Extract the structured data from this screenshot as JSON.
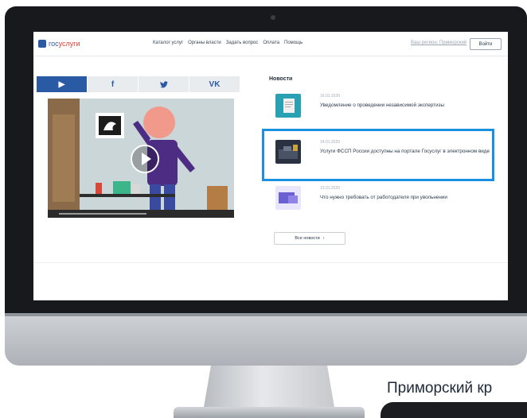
{
  "header": {
    "logo_text_blue": "гос",
    "logo_text_red": "услуги",
    "nav": [
      "Каталог услуг",
      "Органы власти",
      "Задать вопрос",
      "Оплата",
      "Помощь"
    ],
    "search_link": "Ваш регион: Приморский",
    "login_label": "Войти"
  },
  "share": {
    "tabs": [
      {
        "icon": "play-icon",
        "glyph": "▶"
      },
      {
        "icon": "facebook-icon",
        "glyph": "f"
      },
      {
        "icon": "twitter-icon",
        "glyph": "♥"
      },
      {
        "icon": "vk-icon",
        "glyph": "VK"
      }
    ]
  },
  "news": {
    "title": "Новости",
    "items": [
      {
        "date": "16.01.2020",
        "text": "Уведомление о проведении независимой экспертизы",
        "thumb_color": "#2aa1b3"
      },
      {
        "date": "14.01.2020",
        "text": "Услуги ФССП России доступны на портале Госуслуг в электронном виде",
        "thumb_color": "#2a3140"
      },
      {
        "date": "13.01.2020",
        "text": "Что нужно требовать от работодателя при увольнении",
        "thumb_color": "#6c5fd1"
      }
    ],
    "all_news_label": "Все новости",
    "all_news_arrow": "›"
  },
  "region_label": "Приморский кр"
}
